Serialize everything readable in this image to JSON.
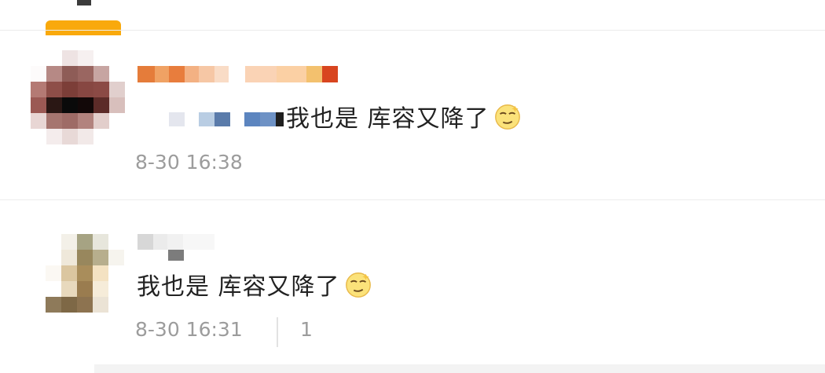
{
  "comments": [
    {
      "text": "我也是 库容又降了",
      "time": "8-30 16:38",
      "emoji": "dizzy-face-emoji"
    },
    {
      "text": "我也是 库容又降了",
      "time": "8-30 16:31",
      "emoji": "dizzy-face-emoji",
      "count": "1"
    }
  ],
  "colors": {
    "accent_tab": "#f9a90c",
    "timestamp": "#9c9c9c",
    "text": "#222222",
    "divider": "#ececec"
  }
}
